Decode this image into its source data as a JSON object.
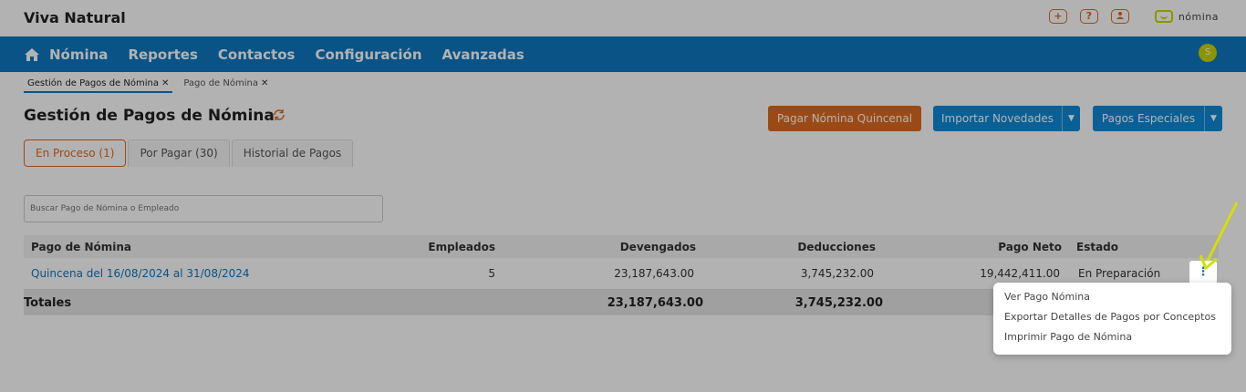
{
  "app": {
    "title": "Viva Natural",
    "logo_text": "nómina"
  },
  "top_icons": [
    {
      "name": "add-icon",
      "glyph": "+"
    },
    {
      "name": "help-icon",
      "glyph": "?"
    },
    {
      "name": "user-icon",
      "glyph": "●"
    }
  ],
  "nav": {
    "items": [
      "Nómina",
      "Reportes",
      "Contactos",
      "Configuración",
      "Avanzadas"
    ],
    "avatar": "S"
  },
  "crumbs": [
    {
      "label": "Gestión de Pagos de Nómina",
      "active": true
    },
    {
      "label": "Pago de Nómina",
      "active": false
    }
  ],
  "page": {
    "title": "Gestión de Pagos de Nómina",
    "btn_pagar": "Pagar Nómina Quincenal",
    "btn_importar": "Importar Novedades",
    "btn_especiales": "Pagos Especiales"
  },
  "subtabs": [
    "En Proceso (1)",
    "Por Pagar (30)",
    "Historial de Pagos"
  ],
  "search": {
    "placeholder": "Buscar Pago de Nómina o Empleado"
  },
  "table": {
    "headers": [
      "Pago de Nómina",
      "Empleados",
      "Devengados",
      "Deducciones",
      "Pago Neto",
      "Estado"
    ],
    "rows": [
      [
        "Quincena del 16/08/2024 al 31/08/2024",
        "5",
        "23,187,643.00",
        "3,745,232.00",
        "19,442,411.00",
        "En Preparación"
      ]
    ],
    "totals": {
      "label": "Totales",
      "devengados": "23,187,643.00",
      "deducciones": "3,745,232.00"
    }
  },
  "menu": {
    "items": [
      "Ver Pago Nómina",
      "Exportar Detalles de Pagos por Conceptos",
      "Imprimir Pago de Nómina"
    ]
  },
  "colors": {
    "nav": "#0d78c0",
    "accent": "#e06a1f",
    "brand": "#c9d400",
    "highlight_arrow": "#d4e000"
  }
}
